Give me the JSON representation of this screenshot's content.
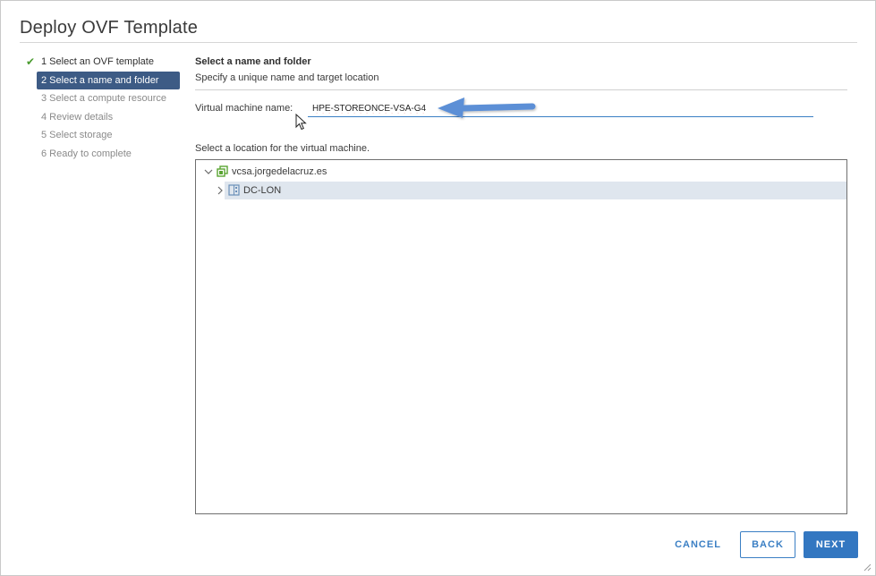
{
  "dialog": {
    "title": "Deploy OVF Template"
  },
  "steps": [
    {
      "label": "1 Select an OVF template",
      "state": "done"
    },
    {
      "label": "2 Select a name and folder",
      "state": "active"
    },
    {
      "label": "3 Select a compute resource",
      "state": "pending"
    },
    {
      "label": "4 Review details",
      "state": "pending"
    },
    {
      "label": "5 Select storage",
      "state": "pending"
    },
    {
      "label": "6 Ready to complete",
      "state": "pending"
    }
  ],
  "main": {
    "section_title": "Select a name and folder",
    "section_subtitle": "Specify a unique name and target location",
    "vm_name_label": "Virtual machine name:",
    "vm_name_value": "HPE-STOREONCE-VSA-G4",
    "location_label": "Select a location for the virtual machine."
  },
  "tree": {
    "items": [
      {
        "label": "vcsa.jorgedelacruz.es",
        "icon": "vcenter-icon",
        "expanded": true
      },
      {
        "label": "DC-LON",
        "icon": "datacenter-icon",
        "expanded": false,
        "selected": true
      }
    ]
  },
  "footer": {
    "cancel_label": "CANCEL",
    "back_label": "BACK",
    "next_label": "NEXT"
  },
  "colors": {
    "accent": "#3377c1",
    "active_step_bg": "#3d5b85",
    "check": "#4a9b2f",
    "selected_row": "#dfe6ee",
    "annotation_arrow": "#5b8fd6"
  }
}
